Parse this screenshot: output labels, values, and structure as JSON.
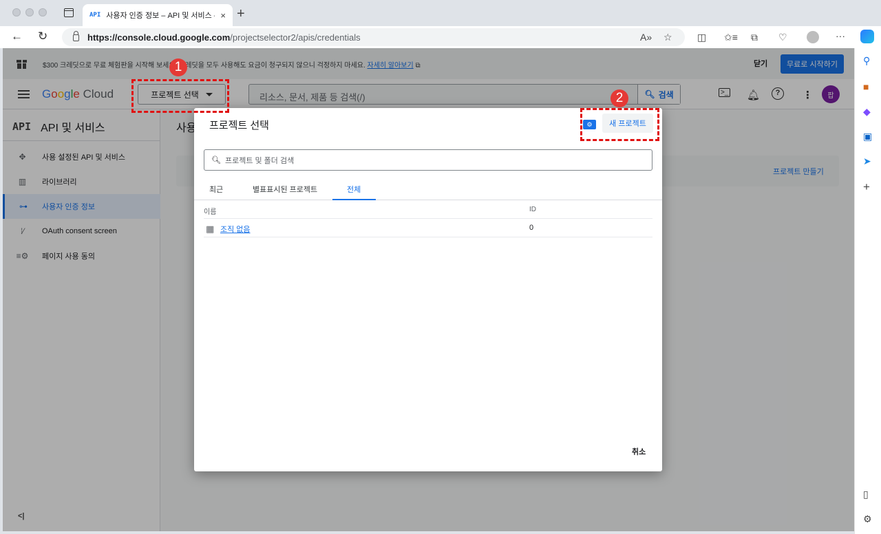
{
  "browser": {
    "tab_favicon": "API",
    "tab_title": "사용자 인증 정보 – API 및 서비스 –",
    "tab_close": "×",
    "new_tab": "+",
    "url_host": "https://console.cloud.google.com",
    "url_path": "/projectselector2/apis/credentials",
    "icons": [
      "back-icon",
      "reload-icon",
      "read-aloud-icon",
      "favorite-icon",
      "split-screen-icon",
      "favorites-icon",
      "collections-icon",
      "performance-icon",
      "profile-icon",
      "more-icon",
      "copilot-icon"
    ]
  },
  "edge_sidebar": {
    "icons": [
      "search-icon",
      "tools-icon",
      "office-icon",
      "outlook-icon",
      "telegram-icon",
      "add-icon",
      "sidebar-toggle-icon",
      "settings-icon"
    ]
  },
  "promo": {
    "text": "$300 크레딧으로 무료 체험판을 시작해 보세요. 크레딧을 모두 사용해도 요금이 청구되지 않으니 걱정하지 마세요.",
    "link": "자세히 알아보기",
    "dismiss": "닫기",
    "start": "무료로 시작하기"
  },
  "header": {
    "logo": "Google Cloud",
    "project_select": "프로젝트 선택",
    "search_placeholder": "리소스, 문서, 제품 등 검색(/)",
    "search_button": "검색",
    "avatar": "팝"
  },
  "sidebar": {
    "title_icon": "API",
    "title": "API 및 서비스",
    "items": [
      {
        "label": "사용 설정된 API 및 서비스",
        "icon": "enabled-apis-icon"
      },
      {
        "label": "라이브러리",
        "icon": "library-icon"
      },
      {
        "label": "사용자 인증 정보",
        "icon": "key-icon"
      },
      {
        "label": "OAuth consent screen",
        "icon": "consent-icon"
      },
      {
        "label": "페이지 사용 동의",
        "icon": "page-agreement-icon"
      }
    ],
    "collapse": "<|"
  },
  "main": {
    "title": "사용",
    "make_project": "프로젝트 만들기"
  },
  "dialog": {
    "title": "프로젝트 선택",
    "new_project": "새 프로젝트",
    "search_placeholder": "프로젝트 및 폴더 검색",
    "tabs": [
      "최근",
      "별표표시된 프로젝트",
      "전체"
    ],
    "active_tab": "전체",
    "columns": [
      "이름",
      "ID"
    ],
    "rows": [
      {
        "name": "조직 없음",
        "id": "0"
      }
    ],
    "cancel": "취소"
  },
  "annotations": [
    "1",
    "2"
  ],
  "colors": {
    "accent": "#1a73e8",
    "annotation": "#e53935",
    "avatar": "#7b1fa2"
  }
}
